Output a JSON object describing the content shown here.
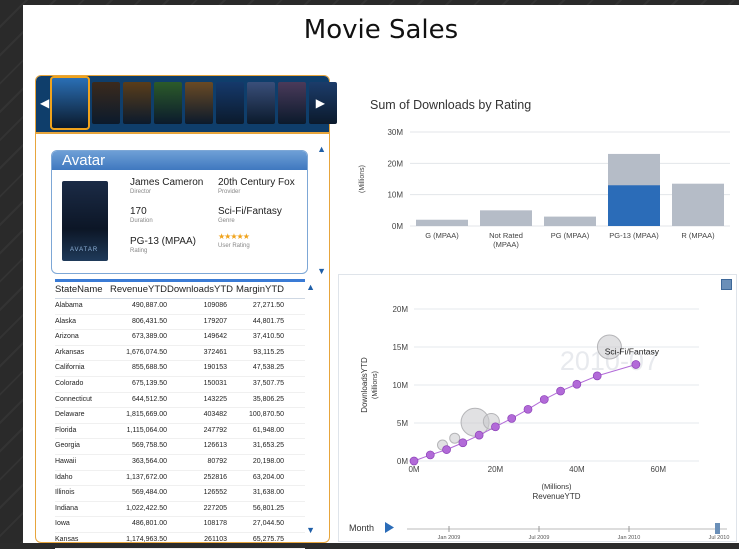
{
  "page": {
    "title": "Movie Sales"
  },
  "filmstrip": {
    "posters": [
      "#2a6fb5",
      "#3b2a1c",
      "#5a3d1a",
      "#2c5b2a",
      "#6a4a24",
      "#15396b",
      "#3a4f7a",
      "#4a3a5a",
      "#1c3c6a"
    ]
  },
  "movie": {
    "title": "Avatar",
    "director": "James Cameron",
    "director_label": "Director",
    "provider": "20th Century Fox",
    "provider_label": "Provider",
    "duration": "170",
    "duration_label": "Duration",
    "genre": "Sci-Fi/Fantasy",
    "genre_label": "Genre",
    "rating": "PG-13 (MPAA)",
    "rating_label": "Rating",
    "user_rating_label": "User Rating",
    "user_rating_stars": "★★★★★",
    "poster_text": "AVATAR"
  },
  "state_table": {
    "headers": [
      "StateName",
      "RevenueYTD",
      "DownloadsYTD",
      "MarginYTD"
    ],
    "rows": [
      [
        "Alabama",
        "490,887.00",
        "109086",
        "27,271.50"
      ],
      [
        "Alaska",
        "806,431.50",
        "179207",
        "44,801.75"
      ],
      [
        "Arizona",
        "673,389.00",
        "149642",
        "37,410.50"
      ],
      [
        "Arkansas",
        "1,676,074.50",
        "372461",
        "93,115.25"
      ],
      [
        "California",
        "855,688.50",
        "190153",
        "47,538.25"
      ],
      [
        "Colorado",
        "675,139.50",
        "150031",
        "37,507.75"
      ],
      [
        "Connecticut",
        "644,512.50",
        "143225",
        "35,806.25"
      ],
      [
        "Delaware",
        "1,815,669.00",
        "403482",
        "100,870.50"
      ],
      [
        "Florida",
        "1,115,064.00",
        "247792",
        "61,948.00"
      ],
      [
        "Georgia",
        "569,758.50",
        "126613",
        "31,653.25"
      ],
      [
        "Hawaii",
        "363,564.00",
        "80792",
        "20,198.00"
      ],
      [
        "Idaho",
        "1,137,672.00",
        "252816",
        "63,204.00"
      ],
      [
        "Illinois",
        "569,484.00",
        "126552",
        "31,638.00"
      ],
      [
        "Indiana",
        "1,022,422.50",
        "227205",
        "56,801.25"
      ],
      [
        "Iowa",
        "486,801.00",
        "108178",
        "27,044.50"
      ],
      [
        "Kansas",
        "1,174,963.50",
        "261103",
        "65,275.75"
      ]
    ]
  },
  "chart_data": [
    {
      "type": "bar",
      "title": "Sum of Downloads by Rating",
      "ylabel": "(Millions)",
      "categories": [
        "G (MPAA)",
        "Not Rated (MPAA)",
        "PG (MPAA)",
        "PG-13 (MPAA)",
        "R (MPAA)"
      ],
      "category_lines": [
        [
          "G (MPAA)"
        ],
        [
          "Not Rated",
          "(MPAA)"
        ],
        [
          "PG (MPAA)"
        ],
        [
          "PG-13 (MPAA)"
        ],
        [
          "R (MPAA)"
        ]
      ],
      "yticks": [
        "0M",
        "10M",
        "20M",
        "30M"
      ],
      "ylim": [
        0,
        30
      ],
      "series": [
        {
          "values": [
            2,
            5,
            3,
            23,
            13.5
          ],
          "color": "#b5bcc7"
        },
        {
          "values": [
            0,
            0,
            0,
            13,
            0
          ],
          "color": "#2b6cb8"
        }
      ],
      "grid": true
    },
    {
      "type": "scatter",
      "ylabel": "DownloadsYTD",
      "ylabel_units": "(Millions)",
      "xlabel": "RevenueYTD",
      "xlabel_units": "(Millions)",
      "xticks": [
        "0M",
        "20M",
        "40M",
        "60M"
      ],
      "yticks": [
        "0M",
        "5M",
        "10M",
        "15M",
        "20M"
      ],
      "xlim": [
        0,
        70
      ],
      "ylim": [
        0,
        20
      ],
      "watermark": "2010-07",
      "highlight_label": "Sci-Fi/Fantasy",
      "highlight_color": "#b26ad8",
      "trail_points": [
        [
          0,
          0
        ],
        [
          4,
          0.8
        ],
        [
          8,
          1.5
        ],
        [
          12,
          2.4
        ],
        [
          16,
          3.4
        ],
        [
          20,
          4.5
        ],
        [
          24,
          5.6
        ],
        [
          28,
          6.8
        ],
        [
          32,
          8.1
        ],
        [
          36,
          9.2
        ],
        [
          40,
          10.1
        ],
        [
          45,
          11.2
        ],
        [
          54.5,
          12.7
        ]
      ],
      "ghost_bubbles": [
        [
          15,
          5.1,
          14
        ],
        [
          19,
          5.2,
          8
        ],
        [
          7,
          2.1,
          5
        ],
        [
          10,
          3,
          5
        ],
        [
          48,
          15,
          12
        ]
      ],
      "month_label": "Month",
      "timeline_ticks": [
        "Jan 2009",
        "Jul 2009",
        "Jan 2010",
        "Jul 2010"
      ]
    }
  ]
}
